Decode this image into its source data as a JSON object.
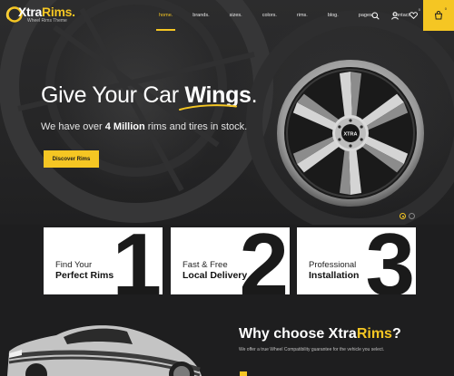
{
  "header": {
    "logo": {
      "word_main": "Xtra",
      "word_accent": "Rims",
      "dot": ".",
      "tagline": "Wheel Rims Theme"
    },
    "nav": [
      {
        "label": "home.",
        "active": true
      },
      {
        "label": "brands.",
        "active": false
      },
      {
        "label": "sizes.",
        "active": false
      },
      {
        "label": "colors.",
        "active": false
      },
      {
        "label": "rims.",
        "active": false
      },
      {
        "label": "blog.",
        "active": false
      },
      {
        "label": "pages.",
        "active": false
      },
      {
        "label": "contact.",
        "active": false
      }
    ],
    "icons": {
      "search": "search-icon",
      "account": "user-icon",
      "wishlist": "heart-icon",
      "cart": "cart-icon"
    },
    "wishlist_count": "0",
    "cart_count": "0"
  },
  "hero": {
    "title_prefix": "Give Your Car ",
    "title_emphasis": "Wings",
    "title_suffix": ".",
    "subtitle_prefix": "We have over ",
    "subtitle_emphasis": "4 Million",
    "subtitle_suffix": " rims and tires in stock.",
    "cta_label": "Discover Rims",
    "wheel_brand": "XTRA",
    "slides": 2,
    "active_slide": 1
  },
  "features": [
    {
      "line1": "Find Your",
      "line2": "Perfect Rims",
      "number": "1"
    },
    {
      "line1": "Fast & Free",
      "line2": "Local Delivery",
      "number": "2"
    },
    {
      "line1": "Professional",
      "line2": "Installation",
      "number": "3"
    }
  ],
  "why": {
    "title_prefix": "Why choose Xtra",
    "title_accent": "Rims",
    "title_suffix": "?",
    "subtitle": "We offer a true Wheel Compatibility guarantee for the vehicle you select."
  },
  "colors": {
    "accent": "#f5c623",
    "dark": "#1e1e1f",
    "card": "#ffffff"
  }
}
